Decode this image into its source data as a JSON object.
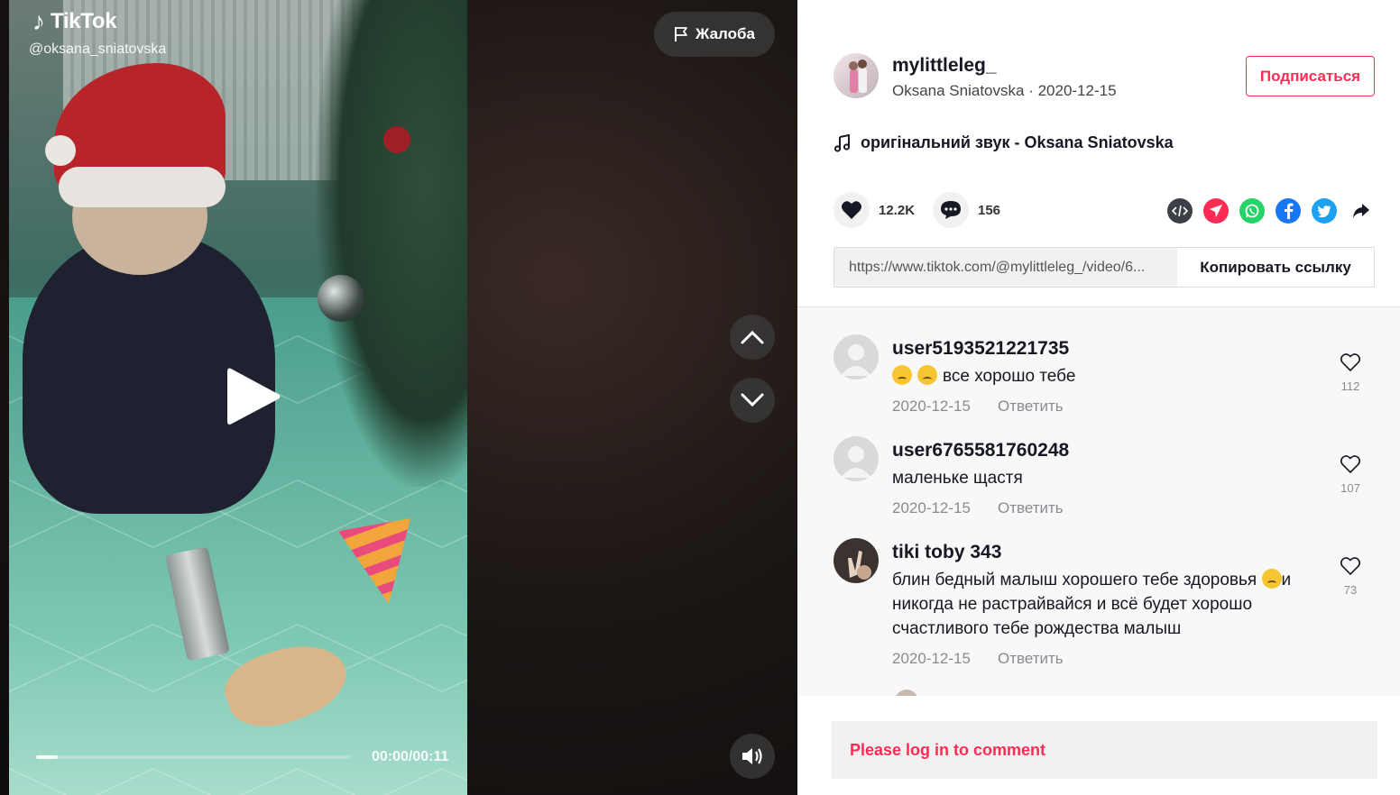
{
  "video": {
    "brand": "TikTok",
    "watermark_username": "@oksana_sniatovska",
    "report_label": "Жалоба",
    "time_readout": "00:00/00:11",
    "progress_fraction": 0.07
  },
  "author": {
    "username": "mylittleleg_",
    "display_name": "Oksana Sniatovska",
    "date": "2020-12-15",
    "meta_separator": " · ",
    "follow_label": "Подписаться"
  },
  "music": {
    "icon": "music-note-icon",
    "title": "оригінальний звук - Oksana Sniatovska"
  },
  "stats": {
    "likes": "12.2K",
    "comments": "156"
  },
  "share": {
    "icons": [
      "embed-icon",
      "telegram-icon",
      "whatsapp-icon",
      "facebook-icon",
      "twitter-icon",
      "share-arrow-icon"
    ],
    "colors": {
      "embed": "#3c3f45",
      "telegram": "#fe2c55",
      "whatsapp": "#25d366",
      "facebook": "#1877f2",
      "twitter": "#1da1f2"
    }
  },
  "link": {
    "url": "https://www.tiktok.com/@mylittleleg_/video/6...",
    "copy_label": "Копировать ссылку"
  },
  "comments": [
    {
      "user": "user5193521221735",
      "text": "все хорошо тебе",
      "emoji_count": 2,
      "date": "2020-12-15",
      "reply_label": "Ответить",
      "likes": "112"
    },
    {
      "user": "user6765581760248",
      "text": "маленьке щастя",
      "emoji_count": 0,
      "date": "2020-12-15",
      "reply_label": "Ответить",
      "likes": "107"
    },
    {
      "user": "tiki toby 343",
      "text_before_emoji": "блин бедный малыш хорошего тебе здоровья ",
      "text_after_emoji": "и никогда не растрайвайся и всё будет хорошо счастливого тебе рождества малыш",
      "date": "2020-12-15",
      "reply_label": "Ответить",
      "likes": "73"
    }
  ],
  "login_prompt": "Please log in to comment",
  "colors": {
    "accent": "#fe2c55",
    "text": "#161823",
    "muted": "#8a8b91"
  }
}
